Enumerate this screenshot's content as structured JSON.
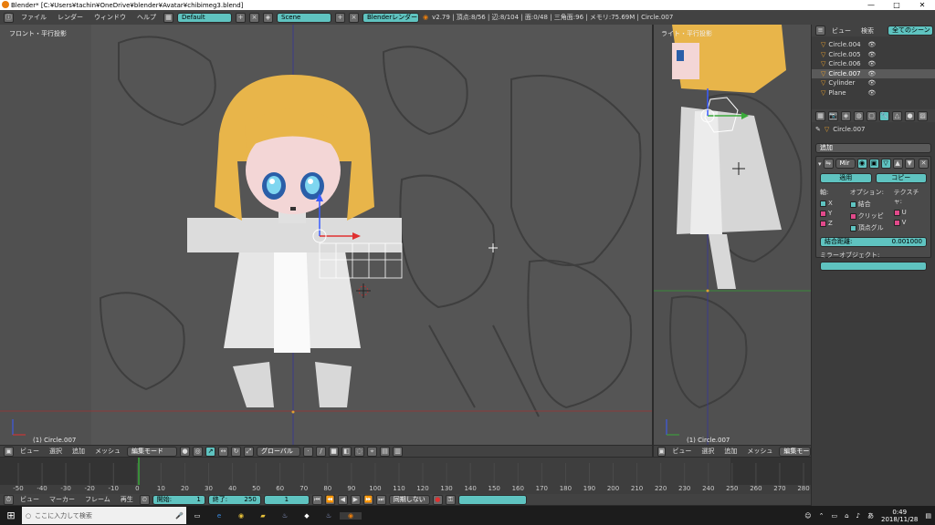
{
  "window": {
    "title": "Blender* [C:¥Users¥tachin¥OneDrive¥blender¥Avatar¥chibimeg3.blend]",
    "minimize": "—",
    "maximize": "□",
    "close": "✕"
  },
  "topbar": {
    "menus": [
      "ファイル",
      "レンダー",
      "ウィンドウ",
      "ヘルプ"
    ],
    "layout": "Default",
    "scene": "Scene",
    "engine": "Blenderレンダー",
    "stats": "v2.79 | 頂点:8/56 | 辺:8/104 | 面:0/48 | 三角面:96 | メモリ:75.69M | Circle.007"
  },
  "viewport_left": {
    "label": "フロント・平行投影",
    "object": "(1) Circle.007",
    "header": {
      "menus": [
        "ビュー",
        "選択",
        "追加",
        "メッシュ"
      ],
      "mode": "編集モード",
      "orientation": "グローバル"
    }
  },
  "viewport_right": {
    "label": "ライト・平行投影",
    "object": "(1) Circle.007",
    "header": {
      "menus": [
        "ビュー",
        "選択",
        "追加",
        "メッシュ"
      ],
      "mode": "編集モード"
    }
  },
  "outliner": {
    "tabs": [
      "ビュー",
      "検索"
    ],
    "filter": "全てのシーン",
    "items": [
      {
        "name": "Circle.004"
      },
      {
        "name": "Circle.005"
      },
      {
        "name": "Circle.006"
      },
      {
        "name": "Circle.007"
      },
      {
        "name": "Cylinder"
      },
      {
        "name": "Plane"
      }
    ]
  },
  "properties": {
    "object_name": "Circle.007",
    "add_modifier": "追加",
    "modifier_name": "Mir",
    "apply": "適用",
    "copy": "コピー",
    "axis_label": "軸:",
    "options_label": "オプション:",
    "texture_label": "テクスチャ:",
    "axes": [
      "X",
      "Y",
      "Z"
    ],
    "options": [
      "結合",
      "クリッピ",
      "頂点グル"
    ],
    "textures": [
      "U",
      "V"
    ],
    "merge_label": "結合距離:",
    "merge_value": "0.001000",
    "mirror_object_label": "ミラーオブジェクト:"
  },
  "timeline": {
    "ticks": [
      "-50",
      "-40",
      "-30",
      "-20",
      "-10",
      "0",
      "10",
      "20",
      "30",
      "40",
      "50",
      "60",
      "70",
      "80",
      "90",
      "100",
      "110",
      "120",
      "130",
      "140",
      "150",
      "160",
      "170",
      "180",
      "190",
      "200",
      "210",
      "220",
      "230",
      "240",
      "250",
      "260",
      "270",
      "280"
    ],
    "menus": [
      "ビュー",
      "マーカー",
      "フレーム",
      "再生"
    ],
    "start_label": "開始:",
    "start_value": "1",
    "end_label": "終了:",
    "end_value": "250",
    "current_frame": "1",
    "sync": "同期しない"
  },
  "taskbar": {
    "search_placeholder": "ここに入力して検索",
    "time": "0:49",
    "date": "2018/11/28"
  },
  "colors": {
    "accent": "#5fc3c0",
    "grid_x": "#b03030",
    "grid_y": "#3a8a3a"
  }
}
